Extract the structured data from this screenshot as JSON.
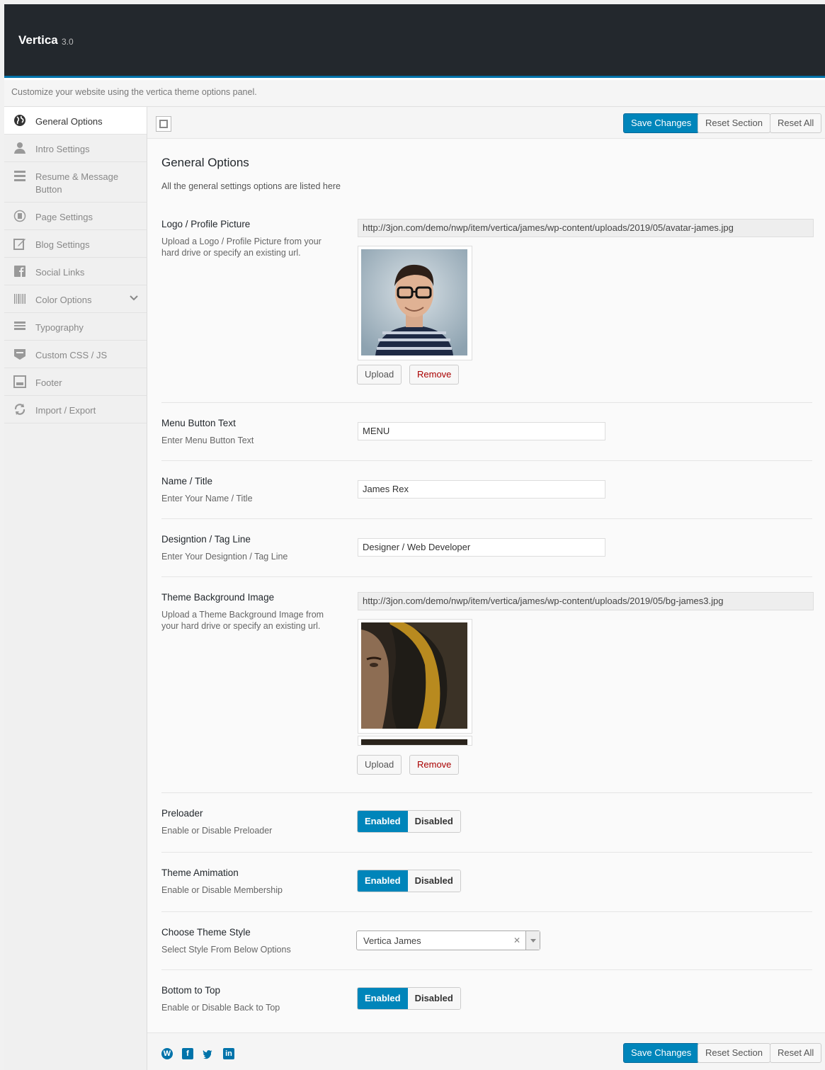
{
  "header": {
    "title": "Vertica",
    "version": "3.0"
  },
  "intro": "Customize your website using the vertica theme options panel.",
  "sidebar": {
    "items": [
      {
        "label": "General Options",
        "icon": "globe-icon"
      },
      {
        "label": "Intro Settings",
        "icon": "user-icon"
      },
      {
        "label": "Resume & Message Button",
        "icon": "menu-icon"
      },
      {
        "label": "Page Settings",
        "icon": "admin-page-icon"
      },
      {
        "label": "Blog Settings",
        "icon": "edit-icon"
      },
      {
        "label": "Social Links",
        "icon": "facebook-icon"
      },
      {
        "label": "Color Options",
        "icon": "barcode-icon"
      },
      {
        "label": "Typography",
        "icon": "typography-icon"
      },
      {
        "label": "Custom CSS / JS",
        "icon": "css-icon"
      },
      {
        "label": "Footer",
        "icon": "footer-icon"
      },
      {
        "label": "Import / Export",
        "icon": "refresh-icon"
      }
    ]
  },
  "toolbar": {
    "save": "Save Changes",
    "reset_section": "Reset Section",
    "reset_all": "Reset All"
  },
  "section": {
    "title": "General Options",
    "desc": "All the general settings options are listed here"
  },
  "fields": {
    "logo": {
      "label": "Logo / Profile Picture",
      "desc": "Upload a Logo / Profile Picture from your hard drive or specify an existing url.",
      "value": "http://3jon.com/demo/nwp/item/vertica/james/wp-content/uploads/2019/05/avatar-james.jpg",
      "upload": "Upload",
      "remove": "Remove"
    },
    "menu_button": {
      "label": "Menu Button Text",
      "desc": "Enter Menu Button Text",
      "value": "MENU"
    },
    "name": {
      "label": "Name / Title",
      "desc": "Enter Your Name / Title",
      "value": "James Rex"
    },
    "designation": {
      "label": "Designtion / Tag Line",
      "desc": "Enter Your Designtion / Tag Line",
      "value": "Designer / Web Developer"
    },
    "background": {
      "label": "Theme Background Image",
      "desc": "Upload a Theme Background Image from your hard drive or specify an existing url.",
      "value": "http://3jon.com/demo/nwp/item/vertica/james/wp-content/uploads/2019/05/bg-james3.jpg",
      "upload": "Upload",
      "remove": "Remove"
    },
    "preloader": {
      "label": "Preloader",
      "desc": "Enable or Disable Preloader",
      "on": "Enabled",
      "off": "Disabled",
      "state": "Enabled"
    },
    "animation": {
      "label": "Theme Amimation",
      "desc": "Enable or Disable Membership",
      "on": "Enabled",
      "off": "Disabled",
      "state": "Enabled"
    },
    "theme_style": {
      "label": "Choose Theme Style",
      "desc": "Select Style From Below Options",
      "value": "Vertica James"
    },
    "back_to_top": {
      "label": "Bottom to Top",
      "desc": "Enable or Disable Back to Top",
      "on": "Enabled",
      "off": "Disabled",
      "state": "Enabled"
    }
  },
  "footer_social": [
    "wordpress-icon",
    "facebook-icon",
    "twitter-icon",
    "linkedin-icon"
  ],
  "colors": {
    "accent": "#0085ba",
    "header_bg": "#23282d",
    "border_accent": "#0073aa"
  }
}
